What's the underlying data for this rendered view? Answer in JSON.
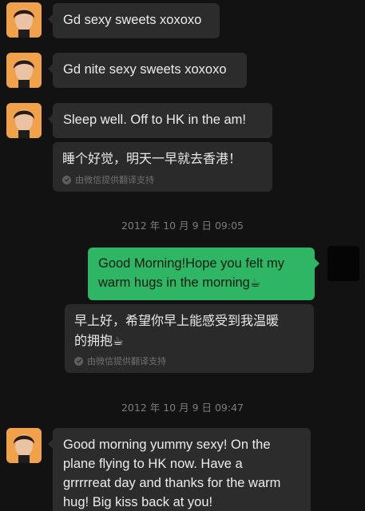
{
  "messages": [
    {
      "text": "Gd sexy sweets xoxoxo"
    },
    {
      "text": "Gd nite sexy sweets xoxoxo"
    },
    {
      "text": "Sleep well.  Off to HK in the am!",
      "translation": "睡个好觉，明天一早就去香港！",
      "translation_note": "由微信提供翻译支持"
    },
    {
      "timestamp": "2012 年 10 月 9 日  09:05"
    },
    {
      "text_line1": "Good Morning!Hope you felt my",
      "text_line2": "warm hugs in the morning",
      "emoji": "☕",
      "translation_line1": "早上好，希望你早上能感受到我温暖",
      "translation_line2": "的拥抱",
      "translation_note": "由微信提供翻译支持"
    },
    {
      "timestamp": "2012 年 10 月 9 日  09:47"
    },
    {
      "line1": "Good morning yummy sexy!  On the",
      "line2": "plane flying to HK now.  Have a",
      "line3": "grrrrreat day and thanks for the warm",
      "line4": "hug!  Big kiss back at you!"
    }
  ],
  "colors": {
    "background": "#121212",
    "incoming_bubble": "#2c2c2c",
    "outgoing_bubble": "#2eb665",
    "avatar_bg": "#f0a14a"
  },
  "icons": [
    "contact-avatar",
    "check-icon",
    "coffee-emoji"
  ]
}
